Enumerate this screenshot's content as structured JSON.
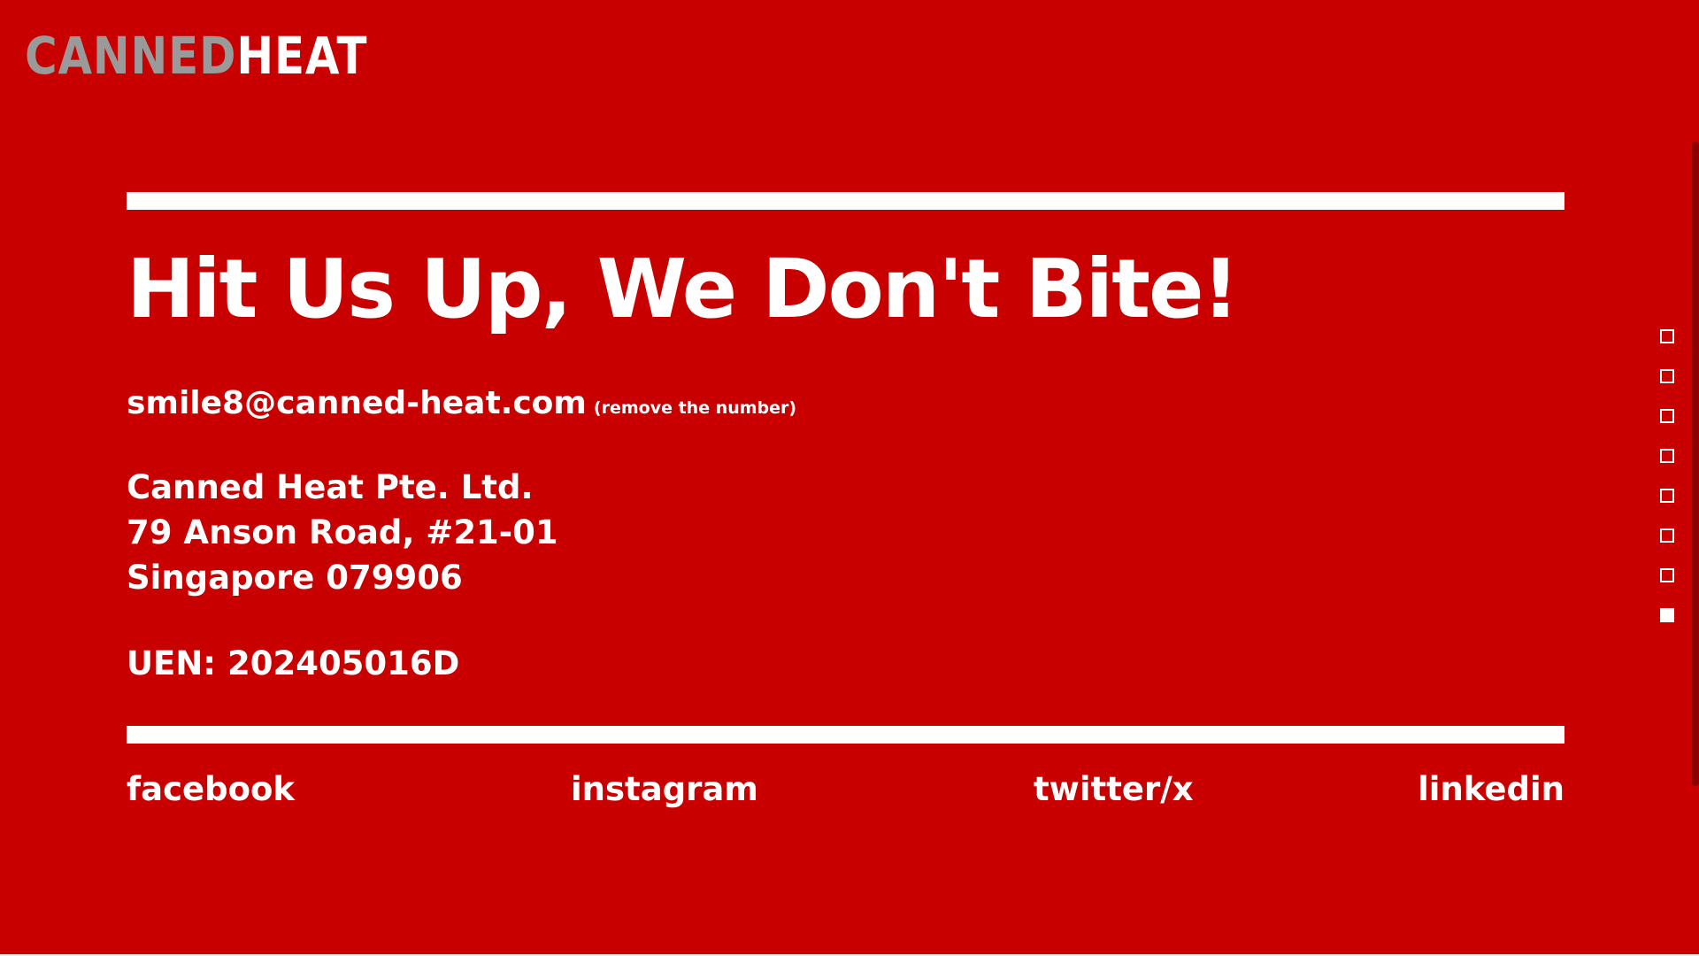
{
  "brand": {
    "logo_part_a": "CANNED",
    "logo_part_b": "HEAT",
    "logo_color_a": "#9a9a9a",
    "logo_color_b": "#ffffff"
  },
  "theme": {
    "background": "#c80000",
    "foreground": "#ffffff"
  },
  "contact": {
    "headline": "Hit Us Up, We Don't Bite!",
    "email": "smile8@canned-heat.com",
    "email_note": "(remove the number)",
    "address_lines": [
      "Canned Heat Pte. Ltd.",
      "79 Anson Road, #21-01",
      "Singapore 079906"
    ],
    "uen": "UEN: 202405016D"
  },
  "social_links": [
    {
      "label": "facebook"
    },
    {
      "label": "instagram"
    },
    {
      "label": "twitter/x"
    },
    {
      "label": "linkedin"
    }
  ],
  "section_nav": {
    "total": 8,
    "active_index": 7
  }
}
